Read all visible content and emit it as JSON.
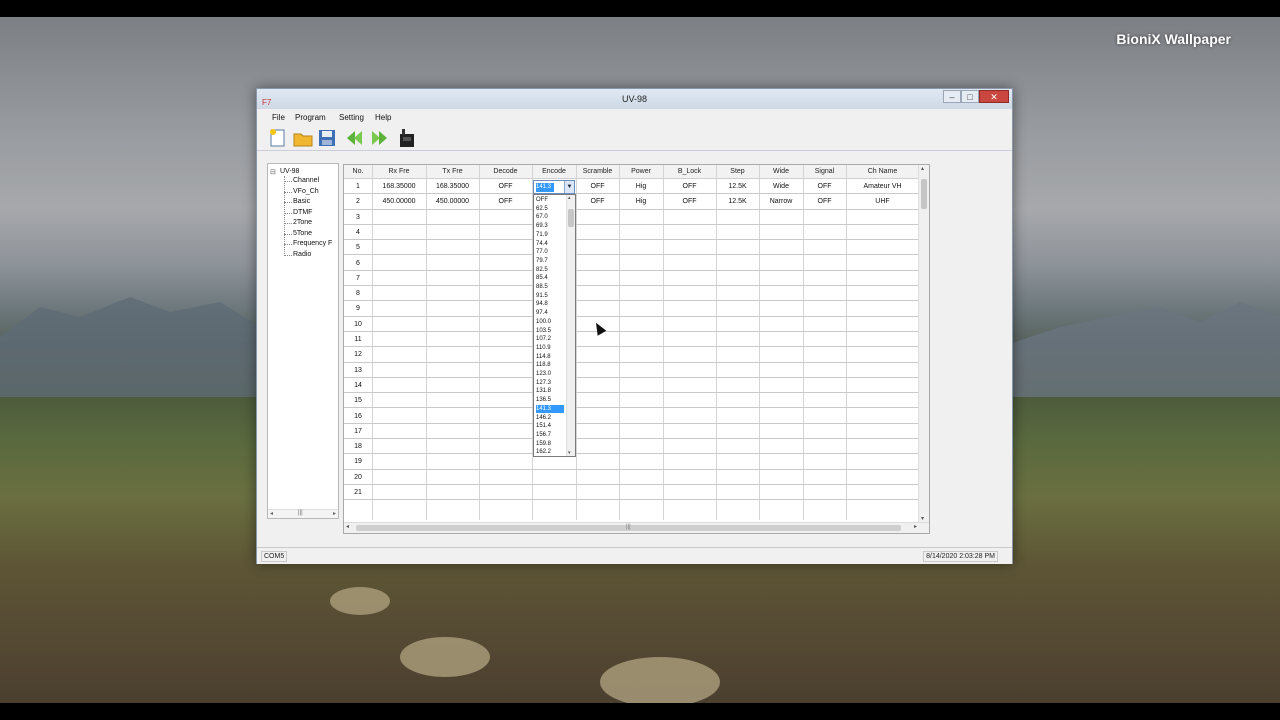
{
  "desktop": {
    "brand": "BioniX Wallpaper"
  },
  "window": {
    "title": "UV-98",
    "app_icon": "F7",
    "controls": {
      "minimize": "–",
      "maximize": "□",
      "close": "✕"
    }
  },
  "menu": [
    "File",
    "Program",
    "Setting",
    "Help"
  ],
  "toolbar": [
    "new-file-icon",
    "open-folder-icon",
    "save-icon",
    "read-back-icon",
    "write-forward-icon",
    "radio-device-icon"
  ],
  "tree": {
    "root": "UV-98",
    "collapse_glyph": "⊟",
    "children": [
      "Channel",
      "VFo_Ch",
      "Basic",
      "DTMF",
      "2Tone",
      "5Tone",
      "Frequency F",
      "Radio"
    ],
    "scroll_left": "◂",
    "scroll_right": "▸",
    "scroll_grip": "|||"
  },
  "grid": {
    "columns": [
      "No.",
      "Rx Fre",
      "Tx Fre",
      "Decode",
      "Encode",
      "Scramble",
      "Power",
      "B_Lock",
      "Step",
      "Wide",
      "Signal",
      "Ch Name"
    ],
    "rows": [
      [
        "1",
        "168.35000",
        "168.35000",
        "OFF",
        "",
        "OFF",
        "Hig",
        "OFF",
        "12.5K",
        "Wide",
        "OFF",
        "Amateur VH"
      ],
      [
        "2",
        "450.00000",
        "450.00000",
        "OFF",
        "",
        "OFF",
        "Hig",
        "OFF",
        "12.5K",
        "Narrow",
        "OFF",
        "UHF"
      ],
      [
        "3"
      ],
      [
        "4"
      ],
      [
        "5"
      ],
      [
        "6"
      ],
      [
        "7"
      ],
      [
        "8"
      ],
      [
        "9"
      ],
      [
        "10"
      ],
      [
        "11"
      ],
      [
        "12"
      ],
      [
        "13"
      ],
      [
        "14"
      ],
      [
        "15"
      ],
      [
        "16"
      ],
      [
        "17"
      ],
      [
        "18"
      ],
      [
        "19"
      ],
      [
        "20"
      ],
      [
        "21"
      ]
    ],
    "scroll_up": "▴",
    "scroll_down": "▾",
    "scroll_left": "◂",
    "scroll_right": "▸",
    "scroll_grip": "|||"
  },
  "encode_dropdown": {
    "current": "141.3",
    "combo_arrow": "▼",
    "scroll_up": "▴",
    "scroll_down": "▾",
    "options": [
      "OFF",
      "62.5",
      "67.0",
      "69.3",
      "71.9",
      "74.4",
      "77.0",
      "79.7",
      "82.5",
      "85.4",
      "88.5",
      "91.5",
      "94.8",
      "97.4",
      "100.0",
      "103.5",
      "107.2",
      "110.9",
      "114.8",
      "118.8",
      "123.0",
      "127.3",
      "131.8",
      "136.5",
      "141.3",
      "146.2",
      "151.4",
      "156.7",
      "159.8",
      "162.2"
    ],
    "selected": "141.3"
  },
  "status": {
    "port": "COM5",
    "time": "8/14/2020 2:03:28 PM"
  },
  "colors": {
    "selection": "#3399ff",
    "close_button": "#c9473f"
  }
}
